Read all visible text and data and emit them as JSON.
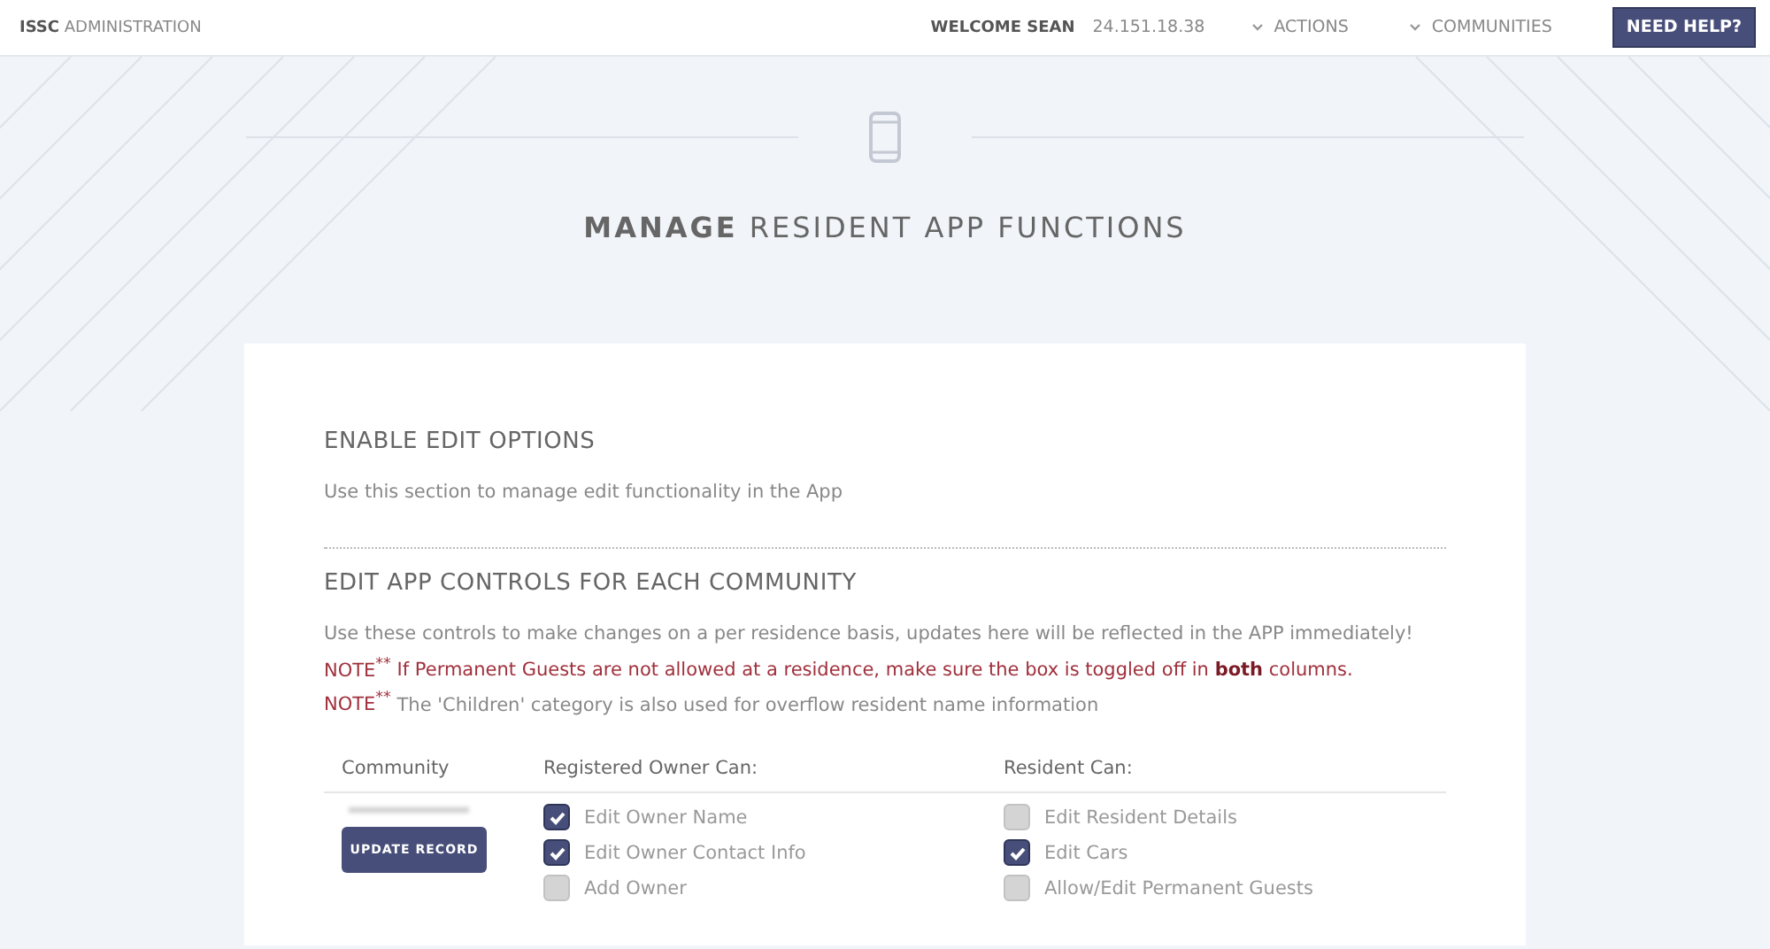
{
  "header": {
    "brand_bold": "ISSC",
    "brand": "ADMINISTRATION",
    "welcome": "WELCOME SEAN",
    "ip": "24.151.18.38",
    "menus": [
      "ACTIONS",
      "COMMUNITIES"
    ],
    "help": "NEED HELP?"
  },
  "page_title": {
    "bold": "MANAGE",
    "rest": "RESIDENT APP FUNCTIONS"
  },
  "section1": {
    "title": "ENABLE EDIT OPTIONS",
    "text": "Use this section to manage edit functionality in the App"
  },
  "section2": {
    "title": "EDIT APP CONTROLS FOR EACH COMMUNITY",
    "text": "Use these controls to make changes on a per residence basis, updates here will be reflected in the APP immediately!",
    "notes": [
      {
        "label": "NOTE$^{**}$",
        "text": "If Permanent Guests are not allowed at a residence, make sure the box is toggled off in **both** columns.",
        "kind": "warning"
      },
      {
        "label": "NOTE$^{**}$",
        "text": "The 'Children' category is also used for overflow resident name information",
        "kind": "info"
      }
    ]
  },
  "table": {
    "columns": [
      "Community",
      "Registered Owner Can:",
      "Resident Can:"
    ],
    "update_button": "UPDATE RECORD",
    "owner": [
      {
        "label": "Edit Owner Name",
        "checked": true
      },
      {
        "label": "Edit Owner Contact Info",
        "checked": true
      },
      {
        "label": "Add Owner",
        "checked": false
      }
    ],
    "resident": [
      {
        "label": "Edit Resident Details",
        "checked": false
      },
      {
        "label": "Edit Cars",
        "checked": true
      },
      {
        "label": "Allow/Edit Permanent Guests",
        "checked": false
      }
    ]
  }
}
